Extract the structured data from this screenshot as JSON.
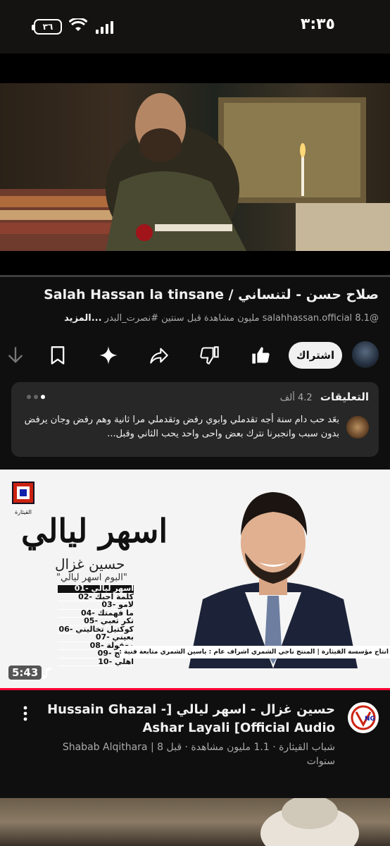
{
  "status": {
    "time": "٣:٣٥",
    "battery": "٣٦"
  },
  "video": {
    "title": "صلاح حسن - لتنساني / Salah Hassan la tinsane",
    "channel_handle": "@salahhassan.official",
    "views": "8.1 مليون مشاهدة",
    "age": "قبل سنتين",
    "hashtag": "#نصرت_البدر",
    "more": "...المزيد",
    "progress": 0.0
  },
  "actions": {
    "subscribe": "اشتراك"
  },
  "comments": {
    "label": "التعليقات",
    "count": "4.2 ألف",
    "text": "بعَد حب دام سنة أجه تقدملي وابوي رفض وتقدملي مرا ثانية وهم رفض وجان يرفض بدون سبب وانجبرنا نترك بعض واحى واحد يحب الثاني وقبل..."
  },
  "next_video": {
    "thumb_title": "اسهر ليالي",
    "thumb_artist": "حسين غزال",
    "thumb_album": "\"البوم اسهر ليالي\"",
    "tracks": [
      "اسهر ليالي -01",
      "كلمة احبك -02",
      "لامو -03",
      "ما فهمتك -04",
      "تكر تعبي -05",
      "كوكتيل تخاليني -06",
      "بعيني -07",
      "معقولة -08",
      "شبيج -09",
      "اهلي -10"
    ],
    "credits": "انتاج مؤسسة القيثارة | المنتج ناجي الشمري   اشراف عام : ياسين الشمري   متابعة فنية : رامي قيثارة",
    "logo_text": "القيثارة",
    "duration": "5:43",
    "title": "حسين غزال - اسهر ليالي [Hussain Ghazal -Ashar Layali  [Official Audio",
    "meta": "شباب القيثارة · 1.1 مليون مشاهدة · قبل 8 | Shabab Alqithara سنوات",
    "progress": 1.0
  },
  "colors": {
    "accent": "#ff0033",
    "background": "#0f0f0f",
    "card": "#272727"
  }
}
